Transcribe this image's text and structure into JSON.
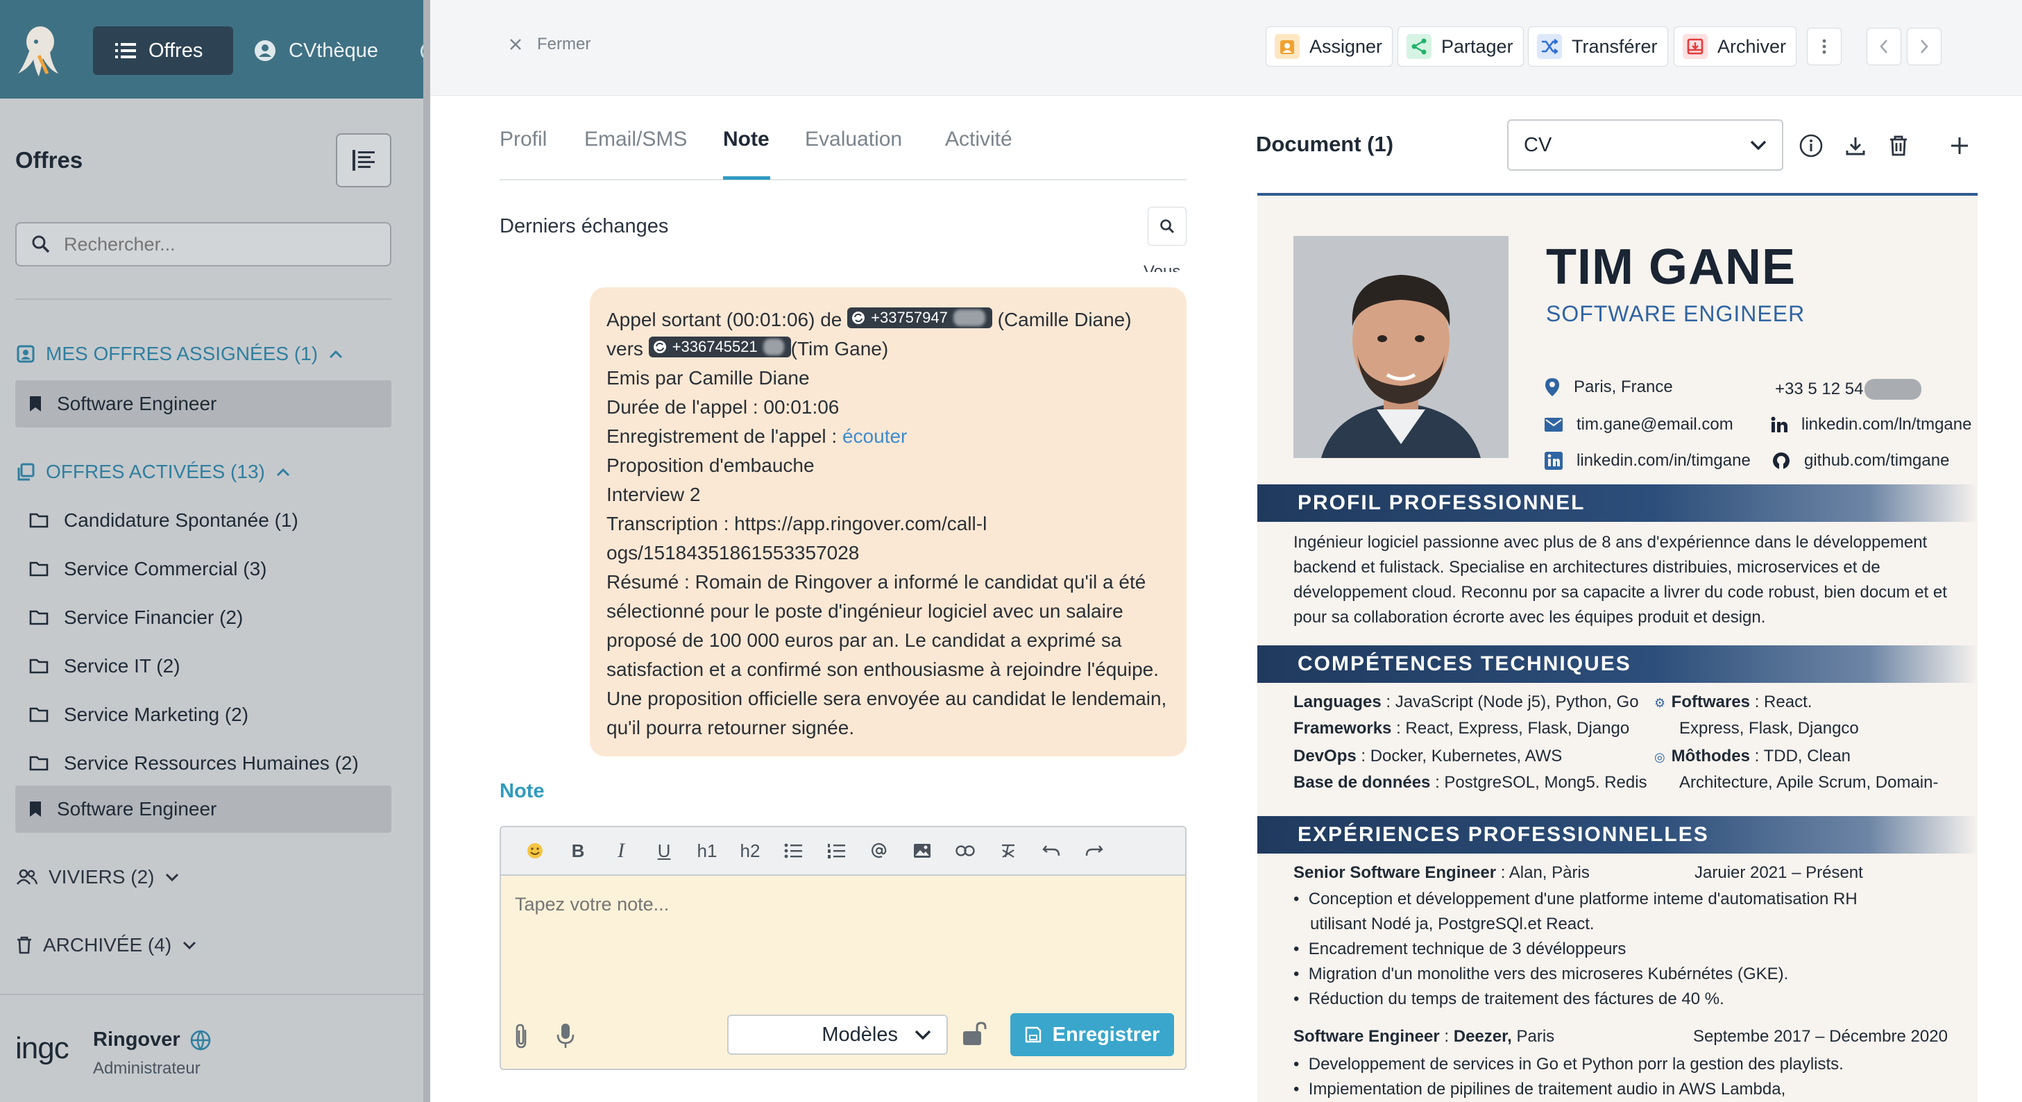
{
  "nav": {
    "offres": "Offres",
    "cvtheque": "CVthèque"
  },
  "sidebar": {
    "title": "Offres",
    "search_placeholder": "Rechercher...",
    "assigned_header": "MES OFFRES ASSIGNÉES (1)",
    "assigned_items": [
      "Software Engineer"
    ],
    "active_header": "OFFRES ACTIVÉES (13)",
    "active_items": [
      "Candidature Spontanée (1)",
      "Service Commercial (3)",
      "Service Financier (2)",
      "Service IT (2)",
      "Service Marketing (2)",
      "Service Ressources Humaines (2)",
      "Software Engineer"
    ],
    "viviers": "VIVIERS (2)",
    "archived": "ARCHIVÉE (4)",
    "company_logo_text": "ingc",
    "company": "Ringover",
    "role": "Administrateur"
  },
  "topbar": {
    "close": "Fermer",
    "assign": "Assigner",
    "share": "Partager",
    "transfer": "Transférer",
    "archive": "Archiver"
  },
  "tabs": [
    "Profil",
    "Email/SMS",
    "Note",
    "Evaluation",
    "Activité"
  ],
  "active_tab": "Note",
  "exchanges": {
    "title": "Derniers échanges",
    "sender": "Vous",
    "message": {
      "l1_a": "Appel sortant (00:01:06) de",
      "phone_from": "+33757947",
      "l1_b": "(Camille Diane)",
      "l2_a": "vers",
      "phone_to": "+336745521",
      "l2_b": "(Tim Gane)",
      "l3": "Emis par Camille Diane",
      "l4": "Durée de l'appel : 00:01:06",
      "l5_a": "Enregistrement de l'appel :",
      "l5_link": "écouter",
      "l6": "Proposition d'embauche",
      "l7": "Interview 2",
      "l8": "Transcription : https://app.ringover.com/call-logs/15184351861553357028",
      "l9": "Résumé : Romain de Ringover a informé le candidat qu'il a été sélectionné pour le poste d'ingénieur logiciel avec un salaire proposé de 100 000 euros par an. Le candidat a exprimé sa satisfaction et a confirmé son enthousiasme à rejoindre l'équipe. Une proposition officielle sera envoyée au candidat le lendemain, qu'il pourra retourner signée."
    }
  },
  "note": {
    "label": "Note",
    "toolbar": [
      "B",
      "I",
      "U",
      "h1",
      "h2"
    ],
    "placeholder": "Tapez votre note...",
    "templates": "Modèles",
    "save": "Enregistrer"
  },
  "document": {
    "title": "Document (1)",
    "selected": "CV"
  },
  "cv": {
    "name": "TIM GANE",
    "role": "SOFTWARE ENGINEER",
    "location": "Paris, France",
    "phone": "+33 5 12 54",
    "email": "tim.gane@email.com",
    "linkedin1": "linkedin.com/ln/tmgane",
    "linkedin2": "linkedin.com/in/timgane",
    "github": "github.com/timgane",
    "profile_header": "PROFIL PROFESSIONNEL",
    "profile_text": "Ingénieur logiciel passionne avec plus de 8 ans d'expériennce dans le développement backend et fulistack. Specialise en architectures distribuies, microservices et de développement cloud. Reconnu por sa capacite a livrer du code robust, bien docum et et pour sa collaboration écrorte avec les équipes produit et design.",
    "skills_header": "COMPÉTENCES TECHNIQUES",
    "skills": [
      {
        "k": "Languages",
        "v": "JavaScript (Node j5), Python, Go"
      },
      {
        "k": "Frameworks",
        "v": "React, Express, Flask, Django"
      },
      {
        "k": "DevOps",
        "v": "Docker, Kubernetes, AWS"
      },
      {
        "k": "Base de données",
        "v": "PostgreSOL, Mong5. Redis"
      }
    ],
    "skills_right": [
      {
        "k": "Foftwares",
        "v": "React."
      },
      {
        "k": "",
        "v": "Express, Flask, Djangco"
      },
      {
        "k": "Môthodes",
        "v": "TDD, Clean"
      },
      {
        "k": "",
        "v": "Architecture, Apile Scrum, Domain-"
      }
    ],
    "exp_header": "EXPÉRIENCES PROFESSIONNELLES",
    "exp1_title": "Senior Software Engineer",
    "exp1_company": "Alan, Pàris",
    "exp1_dates": "Jaruier 2021 – Présent",
    "exp1_bullets": [
      "Conception et développement d'une platforme inteme d'automatisation RH utilisant Nodé ja, PostgreSQl.et React.",
      "Encadrement technique de 3 dévéloppeurs",
      "Migration d'un monolithe vers des microseres Kubérnétes (GKE).",
      "Réduction du temps de traitement des fáctures de 40 %."
    ],
    "exp2_title": "Software Engineer",
    "exp2_company": "Deezer,",
    "exp2_city": "Paris",
    "exp2_dates": "Septembe 2017 – Décembre 2020",
    "exp2_bullets": [
      "Developpement de services in Go et Python porr la gestion des playlists.",
      "Impiementation de pipilines de traitement audio in AWS Lambda,"
    ]
  },
  "colors": {
    "accent": "#3aa6cc",
    "nav": "#3f7184",
    "bubble": "#fbe8d4",
    "cv_band": "#203a5e"
  }
}
